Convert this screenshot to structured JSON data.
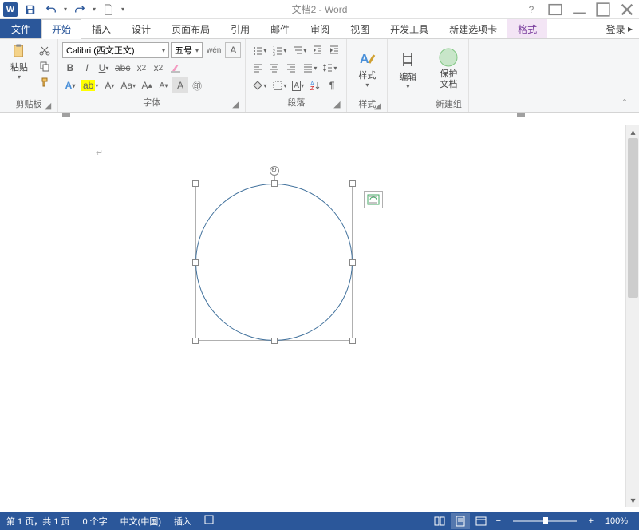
{
  "title": "文档2 - Word",
  "qat": {
    "save": "保存",
    "undo": "撤销",
    "redo": "重做",
    "new": "新建"
  },
  "tabs": {
    "file": "文件",
    "home": "开始",
    "insert": "插入",
    "design": "设计",
    "layout": "页面布局",
    "references": "引用",
    "mailings": "邮件",
    "review": "审阅",
    "view": "视图",
    "developer": "开发工具",
    "newtab": "新建选项卡",
    "format": "格式",
    "login": "登录"
  },
  "clipboard": {
    "paste": "粘贴",
    "group": "剪贴板"
  },
  "font": {
    "name": "Calibri (西文正文)",
    "size": "五号",
    "group": "字体",
    "clear": "清"
  },
  "paragraph": {
    "group": "段落"
  },
  "styles": {
    "label": "样式",
    "group": "样式"
  },
  "editing": {
    "label": "编辑"
  },
  "protect": {
    "label": "保护\n文档",
    "group": "新建组"
  },
  "status": {
    "page": "第 1 页，共 1 页",
    "words": "0 个字",
    "lang": "中文(中国)",
    "mode": "插入",
    "zoom": "100%"
  }
}
